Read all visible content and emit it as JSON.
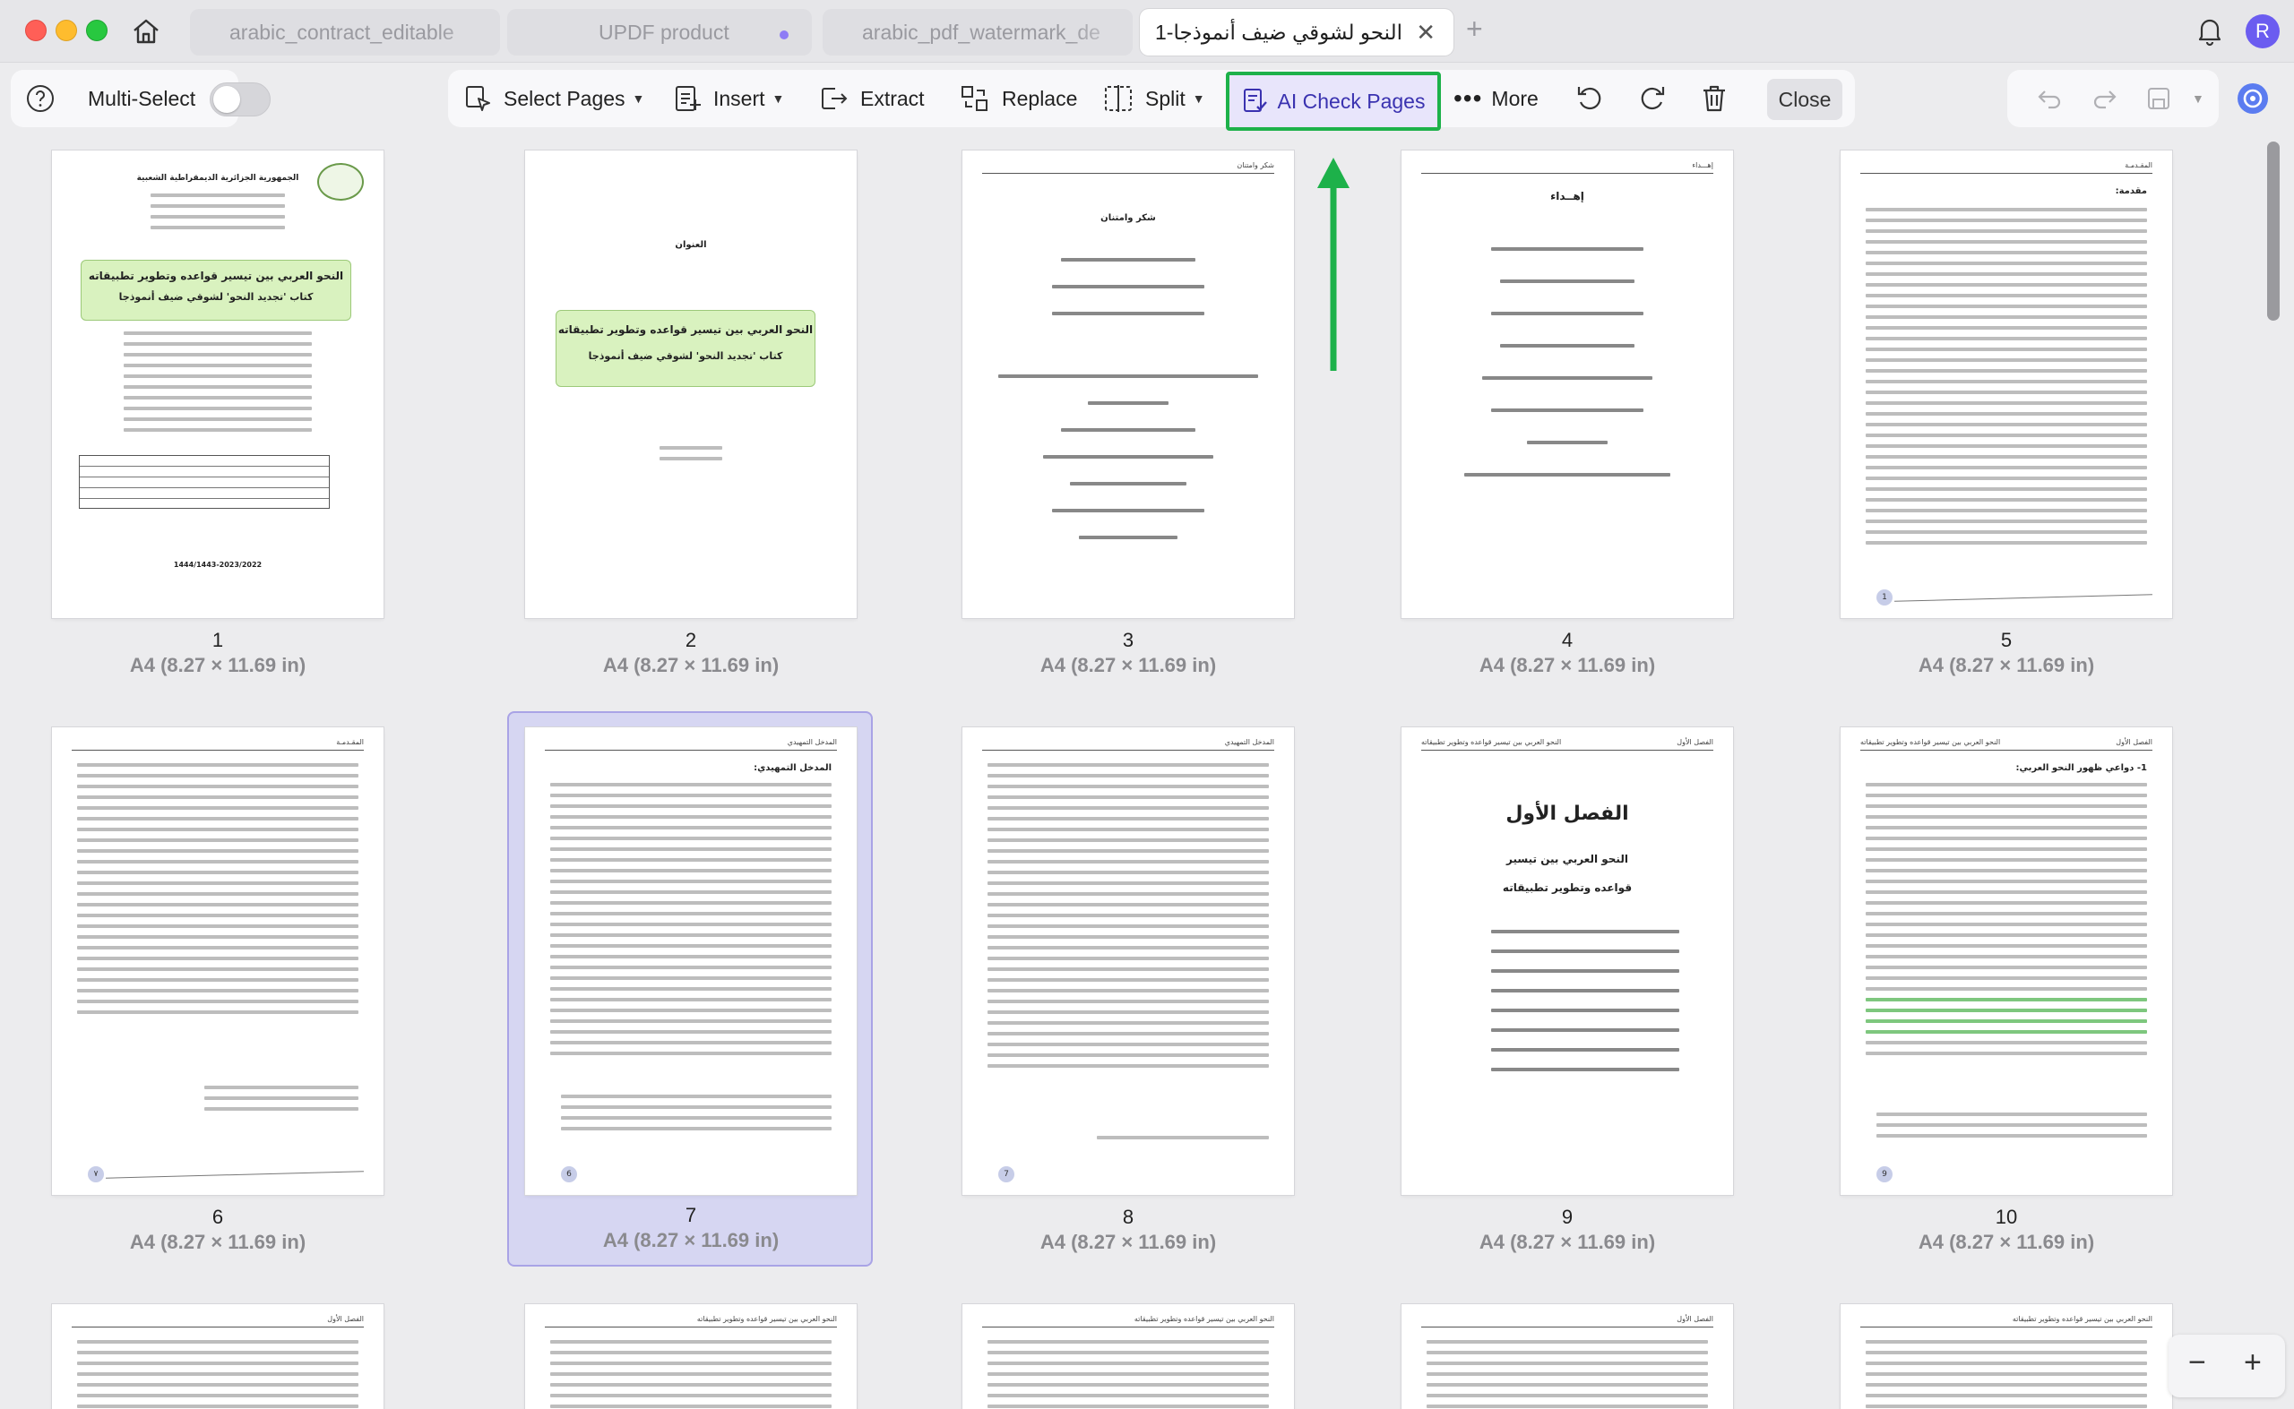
{
  "tabs": [
    {
      "title": "arabic_contract_editable",
      "active": false
    },
    {
      "title": "UPDF product",
      "active": false,
      "modified": true
    },
    {
      "title": "arabic_pdf_watermark_de",
      "active": false
    },
    {
      "title": "النحو لشوقي ضيف أنموذجا-1",
      "active": true
    }
  ],
  "user": {
    "initial": "R"
  },
  "toolbar": {
    "multi_select_label": "Multi-Select",
    "select_pages_label": "Select Pages",
    "insert_label": "Insert",
    "extract_label": "Extract",
    "replace_label": "Replace",
    "split_label": "Split",
    "ai_check_label": "AI Check Pages",
    "more_label": "More",
    "close_label": "Close"
  },
  "colors": {
    "highlight_border": "#1db14a",
    "arrow": "#1db14a",
    "selected_card": "#d6d6f2",
    "accent": "#6b5cf0"
  },
  "pages": [
    {
      "number": "1",
      "size": "A4 (8.27 × 11.69 in)",
      "title_line1": "النحو العربي بين تيسير قواعده وتطوير تطبيقاته",
      "title_line2": "كتاب 'تجديد النحو' لشوقي ضيف أنموذجا",
      "header_line": "الجمهورية الجزائرية الديمقراطية الشعبية",
      "footer_line": "1444/1443-2023/2022"
    },
    {
      "number": "2",
      "size": "A4 (8.27 × 11.69 in)",
      "heading": "العنوان",
      "title_line1": "النحو العربي بين تيسير قواعده وتطوير تطبيقاته",
      "title_line2": "كتاب 'تجديد النحو' لشوقي ضيف أنموذجا"
    },
    {
      "number": "3",
      "size": "A4 (8.27 × 11.69 in)",
      "header_right": "شكر وامتنان",
      "heading": "شكر وامتنان"
    },
    {
      "number": "4",
      "size": "A4 (8.27 × 11.69 in)",
      "header_right": "إهـــداء",
      "heading": "إهــداء"
    },
    {
      "number": "5",
      "size": "A4 (8.27 × 11.69 in)",
      "header_right": "المقـدمـة",
      "heading": "مقدمة:"
    },
    {
      "number": "6",
      "size": "A4 (8.27 × 11.69 in)",
      "header_right": "المقـدمـة"
    },
    {
      "number": "7",
      "size": "A4 (8.27 × 11.69 in)",
      "header_right": "المدخل التمهيدي",
      "heading": "المدخل التمهيدي:",
      "selected": true,
      "circle": "6"
    },
    {
      "number": "8",
      "size": "A4 (8.27 × 11.69 in)",
      "header_right": "المدخل التمهيدي",
      "circle": "7"
    },
    {
      "number": "9",
      "size": "A4 (8.27 × 11.69 in)",
      "header_right": "الفصل الأول",
      "header_left": "النحو العربي بين تيسير قواعده وتطوير تطبيقاته",
      "heading": "الفصل الأول",
      "sub1": "النحو العربي بين تيسير",
      "sub2": "قواعده وتطوير تطبيقاته"
    },
    {
      "number": "10",
      "size": "A4 (8.27 × 11.69 in)",
      "header_right": "الفصل الأول",
      "header_left": "النحو العربي بين تيسير قواعده وتطوير تطبيقاته",
      "heading": "1- دواعي ظهور النحو العربي:",
      "circle": "9"
    }
  ],
  "next_row_headers": [
    "الفصل الأول",
    "النحو العربي بين تيسير قواعده وتطوير تطبيقاته",
    "النحو العربي بين تيسير قواعده وتطوير تطبيقاته",
    "الفصل الأول",
    "النحو العربي بين تيسير قواعده وتطوير تطبيقاته"
  ],
  "zoom": {
    "minus": "−",
    "plus": "+"
  }
}
